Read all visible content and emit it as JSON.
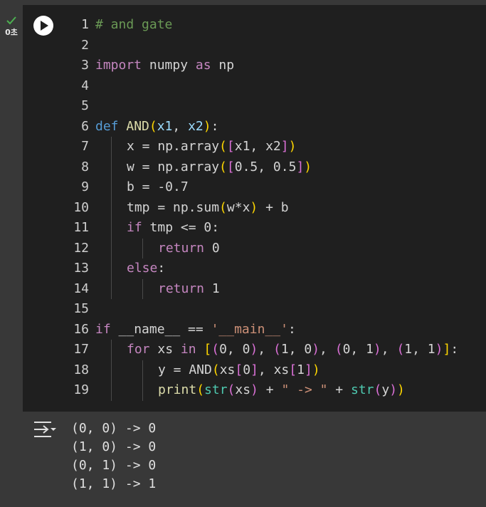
{
  "status": {
    "time": "0초",
    "color": "#4caf50"
  },
  "editor": {
    "colors": {
      "comment": "#6a9955",
      "keyword": "#c586c0",
      "def": "#569cd6",
      "func": "#dcdcaa",
      "param": "#9cdcfe",
      "paren1": "#ffd700",
      "paren2": "#da70d6",
      "paren3": "#179fff",
      "number": "#b5cea8",
      "string": "#ce9178",
      "builtin": "#4ec9b0",
      "plain": "#d4d4d4"
    },
    "lines": [
      {
        "n": "1",
        "indent": 0,
        "tokens": [
          {
            "t": "# and gate",
            "c": "comment"
          }
        ]
      },
      {
        "n": "2",
        "indent": 0,
        "tokens": []
      },
      {
        "n": "3",
        "indent": 0,
        "tokens": [
          {
            "t": "import",
            "c": "keyword"
          },
          {
            "t": " numpy ",
            "c": "plain"
          },
          {
            "t": "as",
            "c": "keyword"
          },
          {
            "t": " np",
            "c": "plain"
          }
        ]
      },
      {
        "n": "4",
        "indent": 0,
        "tokens": []
      },
      {
        "n": "5",
        "indent": 0,
        "tokens": []
      },
      {
        "n": "6",
        "indent": 0,
        "tokens": [
          {
            "t": "def",
            "c": "def"
          },
          {
            "t": " ",
            "c": "plain"
          },
          {
            "t": "AND",
            "c": "func"
          },
          {
            "t": "(",
            "c": "paren1"
          },
          {
            "t": "x1",
            "c": "param"
          },
          {
            "t": ", ",
            "c": "plain"
          },
          {
            "t": "x2",
            "c": "param"
          },
          {
            "t": ")",
            "c": "paren1"
          },
          {
            "t": ":",
            "c": "plain"
          }
        ]
      },
      {
        "n": "7",
        "indent": 1,
        "tokens": [
          {
            "t": "x = np.array",
            "c": "plain"
          },
          {
            "t": "(",
            "c": "paren1"
          },
          {
            "t": "[",
            "c": "paren2"
          },
          {
            "t": "x1, x2",
            "c": "plain"
          },
          {
            "t": "]",
            "c": "paren2"
          },
          {
            "t": ")",
            "c": "paren1"
          }
        ]
      },
      {
        "n": "8",
        "indent": 1,
        "tokens": [
          {
            "t": "w = np.array",
            "c": "plain"
          },
          {
            "t": "(",
            "c": "paren1"
          },
          {
            "t": "[",
            "c": "paren2"
          },
          {
            "t": "0.5, 0.5",
            "c": "plain"
          },
          {
            "t": "]",
            "c": "paren2"
          },
          {
            "t": ")",
            "c": "paren1"
          }
        ]
      },
      {
        "n": "9",
        "indent": 1,
        "tokens": [
          {
            "t": "b = -0.7",
            "c": "plain"
          }
        ]
      },
      {
        "n": "10",
        "indent": 1,
        "tokens": [
          {
            "t": "tmp = np.sum",
            "c": "plain"
          },
          {
            "t": "(",
            "c": "paren1"
          },
          {
            "t": "w*x",
            "c": "plain"
          },
          {
            "t": ")",
            "c": "paren1"
          },
          {
            "t": " + b",
            "c": "plain"
          }
        ]
      },
      {
        "n": "11",
        "indent": 1,
        "tokens": [
          {
            "t": "if",
            "c": "keyword"
          },
          {
            "t": " tmp <= 0:",
            "c": "plain"
          }
        ]
      },
      {
        "n": "12",
        "indent": 2,
        "tokens": [
          {
            "t": "return",
            "c": "keyword"
          },
          {
            "t": " 0",
            "c": "plain"
          }
        ]
      },
      {
        "n": "13",
        "indent": 1,
        "tokens": [
          {
            "t": "else",
            "c": "keyword"
          },
          {
            "t": ":",
            "c": "plain"
          }
        ]
      },
      {
        "n": "14",
        "indent": 2,
        "tokens": [
          {
            "t": "return",
            "c": "keyword"
          },
          {
            "t": " 1",
            "c": "plain"
          }
        ]
      },
      {
        "n": "15",
        "indent": 0,
        "tokens": []
      },
      {
        "n": "16",
        "indent": 0,
        "tokens": [
          {
            "t": "if",
            "c": "keyword"
          },
          {
            "t": " __name__ == ",
            "c": "plain"
          },
          {
            "t": "'__main__'",
            "c": "string"
          },
          {
            "t": ":",
            "c": "plain"
          }
        ]
      },
      {
        "n": "17",
        "indent": 1,
        "tokens": [
          {
            "t": "for",
            "c": "keyword"
          },
          {
            "t": " xs ",
            "c": "plain"
          },
          {
            "t": "in",
            "c": "keyword"
          },
          {
            "t": " ",
            "c": "plain"
          },
          {
            "t": "[",
            "c": "paren1"
          },
          {
            "t": "(",
            "c": "paren2"
          },
          {
            "t": "0, 0",
            "c": "plain"
          },
          {
            "t": ")",
            "c": "paren2"
          },
          {
            "t": ", ",
            "c": "plain"
          },
          {
            "t": "(",
            "c": "paren2"
          },
          {
            "t": "1, 0",
            "c": "plain"
          },
          {
            "t": ")",
            "c": "paren2"
          },
          {
            "t": ", ",
            "c": "plain"
          },
          {
            "t": "(",
            "c": "paren2"
          },
          {
            "t": "0, 1",
            "c": "plain"
          },
          {
            "t": ")",
            "c": "paren2"
          },
          {
            "t": ", ",
            "c": "plain"
          },
          {
            "t": "(",
            "c": "paren2"
          },
          {
            "t": "1, 1",
            "c": "plain"
          },
          {
            "t": ")",
            "c": "paren2"
          },
          {
            "t": "]",
            "c": "paren1"
          },
          {
            "t": ":",
            "c": "plain"
          }
        ]
      },
      {
        "n": "18",
        "indent": 2,
        "tokens": [
          {
            "t": "y = AND",
            "c": "plain"
          },
          {
            "t": "(",
            "c": "paren1"
          },
          {
            "t": "xs",
            "c": "plain"
          },
          {
            "t": "[",
            "c": "paren2"
          },
          {
            "t": "0",
            "c": "plain"
          },
          {
            "t": "]",
            "c": "paren2"
          },
          {
            "t": ", xs",
            "c": "plain"
          },
          {
            "t": "[",
            "c": "paren2"
          },
          {
            "t": "1",
            "c": "plain"
          },
          {
            "t": "]",
            "c": "paren2"
          },
          {
            "t": ")",
            "c": "paren1"
          }
        ]
      },
      {
        "n": "19",
        "indent": 2,
        "tokens": [
          {
            "t": "print",
            "c": "func"
          },
          {
            "t": "(",
            "c": "paren1"
          },
          {
            "t": "str",
            "c": "builtin"
          },
          {
            "t": "(",
            "c": "paren2"
          },
          {
            "t": "xs",
            "c": "plain"
          },
          {
            "t": ")",
            "c": "paren2"
          },
          {
            "t": " + ",
            "c": "plain"
          },
          {
            "t": "\" -> \"",
            "c": "string"
          },
          {
            "t": " + ",
            "c": "plain"
          },
          {
            "t": "str",
            "c": "builtin"
          },
          {
            "t": "(",
            "c": "paren2"
          },
          {
            "t": "y",
            "c": "plain"
          },
          {
            "t": ")",
            "c": "paren2"
          },
          {
            "t": ")",
            "c": "paren1"
          }
        ]
      }
    ]
  },
  "output": {
    "icon": "output-toggle-icon",
    "lines": [
      "(0, 0) -> 0",
      "(1, 0) -> 0",
      "(0, 1) -> 0",
      "(1, 1) -> 1"
    ]
  }
}
